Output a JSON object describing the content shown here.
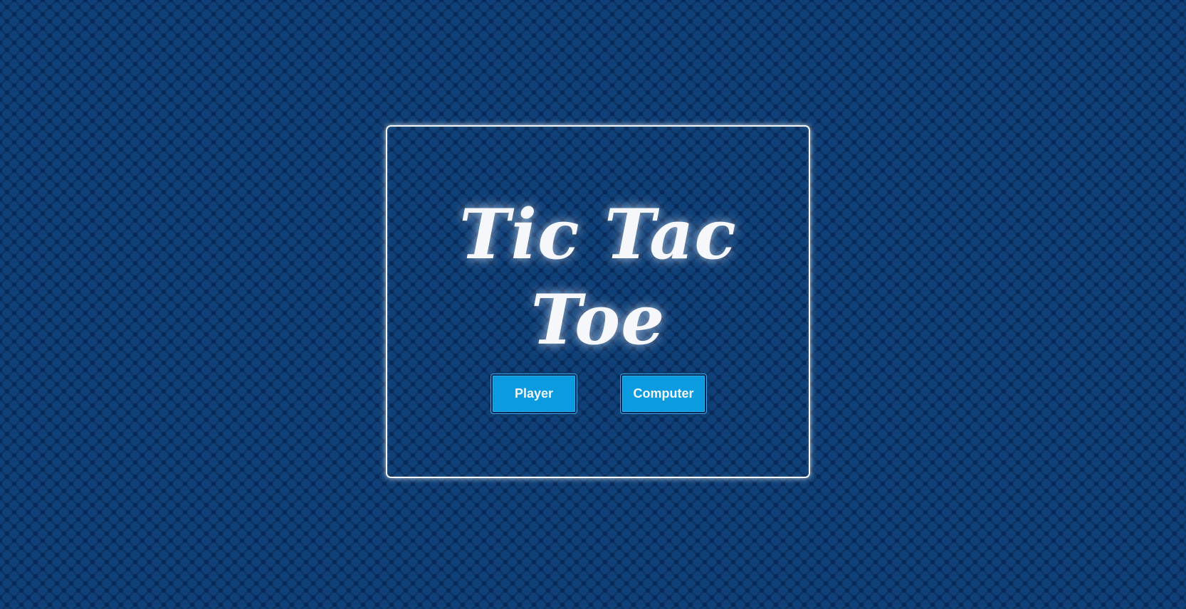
{
  "game": {
    "title": "Tic Tac Toe",
    "modes": {
      "player_label": "Player",
      "computer_label": "Computer"
    }
  },
  "colors": {
    "background": "#0f4178",
    "button": "#0a9be0",
    "text": "#f5f7fa"
  }
}
